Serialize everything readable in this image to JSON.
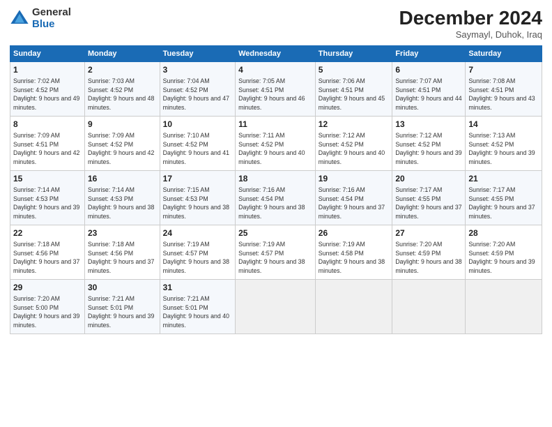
{
  "logo": {
    "general": "General",
    "blue": "Blue"
  },
  "title": "December 2024",
  "subtitle": "Saymayl, Duhok, Iraq",
  "days_of_week": [
    "Sunday",
    "Monday",
    "Tuesday",
    "Wednesday",
    "Thursday",
    "Friday",
    "Saturday"
  ],
  "weeks": [
    [
      {
        "day": "1",
        "sunrise": "7:02 AM",
        "sunset": "4:52 PM",
        "daylight": "9 hours and 49 minutes."
      },
      {
        "day": "2",
        "sunrise": "7:03 AM",
        "sunset": "4:52 PM",
        "daylight": "9 hours and 48 minutes."
      },
      {
        "day": "3",
        "sunrise": "7:04 AM",
        "sunset": "4:52 PM",
        "daylight": "9 hours and 47 minutes."
      },
      {
        "day": "4",
        "sunrise": "7:05 AM",
        "sunset": "4:51 PM",
        "daylight": "9 hours and 46 minutes."
      },
      {
        "day": "5",
        "sunrise": "7:06 AM",
        "sunset": "4:51 PM",
        "daylight": "9 hours and 45 minutes."
      },
      {
        "day": "6",
        "sunrise": "7:07 AM",
        "sunset": "4:51 PM",
        "daylight": "9 hours and 44 minutes."
      },
      {
        "day": "7",
        "sunrise": "7:08 AM",
        "sunset": "4:51 PM",
        "daylight": "9 hours and 43 minutes."
      }
    ],
    [
      {
        "day": "8",
        "sunrise": "7:09 AM",
        "sunset": "4:51 PM",
        "daylight": "9 hours and 42 minutes."
      },
      {
        "day": "9",
        "sunrise": "7:09 AM",
        "sunset": "4:52 PM",
        "daylight": "9 hours and 42 minutes."
      },
      {
        "day": "10",
        "sunrise": "7:10 AM",
        "sunset": "4:52 PM",
        "daylight": "9 hours and 41 minutes."
      },
      {
        "day": "11",
        "sunrise": "7:11 AM",
        "sunset": "4:52 PM",
        "daylight": "9 hours and 40 minutes."
      },
      {
        "day": "12",
        "sunrise": "7:12 AM",
        "sunset": "4:52 PM",
        "daylight": "9 hours and 40 minutes."
      },
      {
        "day": "13",
        "sunrise": "7:12 AM",
        "sunset": "4:52 PM",
        "daylight": "9 hours and 39 minutes."
      },
      {
        "day": "14",
        "sunrise": "7:13 AM",
        "sunset": "4:52 PM",
        "daylight": "9 hours and 39 minutes."
      }
    ],
    [
      {
        "day": "15",
        "sunrise": "7:14 AM",
        "sunset": "4:53 PM",
        "daylight": "9 hours and 39 minutes."
      },
      {
        "day": "16",
        "sunrise": "7:14 AM",
        "sunset": "4:53 PM",
        "daylight": "9 hours and 38 minutes."
      },
      {
        "day": "17",
        "sunrise": "7:15 AM",
        "sunset": "4:53 PM",
        "daylight": "9 hours and 38 minutes."
      },
      {
        "day": "18",
        "sunrise": "7:16 AM",
        "sunset": "4:54 PM",
        "daylight": "9 hours and 38 minutes."
      },
      {
        "day": "19",
        "sunrise": "7:16 AM",
        "sunset": "4:54 PM",
        "daylight": "9 hours and 37 minutes."
      },
      {
        "day": "20",
        "sunrise": "7:17 AM",
        "sunset": "4:55 PM",
        "daylight": "9 hours and 37 minutes."
      },
      {
        "day": "21",
        "sunrise": "7:17 AM",
        "sunset": "4:55 PM",
        "daylight": "9 hours and 37 minutes."
      }
    ],
    [
      {
        "day": "22",
        "sunrise": "7:18 AM",
        "sunset": "4:56 PM",
        "daylight": "9 hours and 37 minutes."
      },
      {
        "day": "23",
        "sunrise": "7:18 AM",
        "sunset": "4:56 PM",
        "daylight": "9 hours and 37 minutes."
      },
      {
        "day": "24",
        "sunrise": "7:19 AM",
        "sunset": "4:57 PM",
        "daylight": "9 hours and 38 minutes."
      },
      {
        "day": "25",
        "sunrise": "7:19 AM",
        "sunset": "4:57 PM",
        "daylight": "9 hours and 38 minutes."
      },
      {
        "day": "26",
        "sunrise": "7:19 AM",
        "sunset": "4:58 PM",
        "daylight": "9 hours and 38 minutes."
      },
      {
        "day": "27",
        "sunrise": "7:20 AM",
        "sunset": "4:59 PM",
        "daylight": "9 hours and 38 minutes."
      },
      {
        "day": "28",
        "sunrise": "7:20 AM",
        "sunset": "4:59 PM",
        "daylight": "9 hours and 39 minutes."
      }
    ],
    [
      {
        "day": "29",
        "sunrise": "7:20 AM",
        "sunset": "5:00 PM",
        "daylight": "9 hours and 39 minutes."
      },
      {
        "day": "30",
        "sunrise": "7:21 AM",
        "sunset": "5:01 PM",
        "daylight": "9 hours and 39 minutes."
      },
      {
        "day": "31",
        "sunrise": "7:21 AM",
        "sunset": "5:01 PM",
        "daylight": "9 hours and 40 minutes."
      },
      null,
      null,
      null,
      null
    ]
  ],
  "labels": {
    "sunrise": "Sunrise:",
    "sunset": "Sunset:",
    "daylight": "Daylight:"
  }
}
